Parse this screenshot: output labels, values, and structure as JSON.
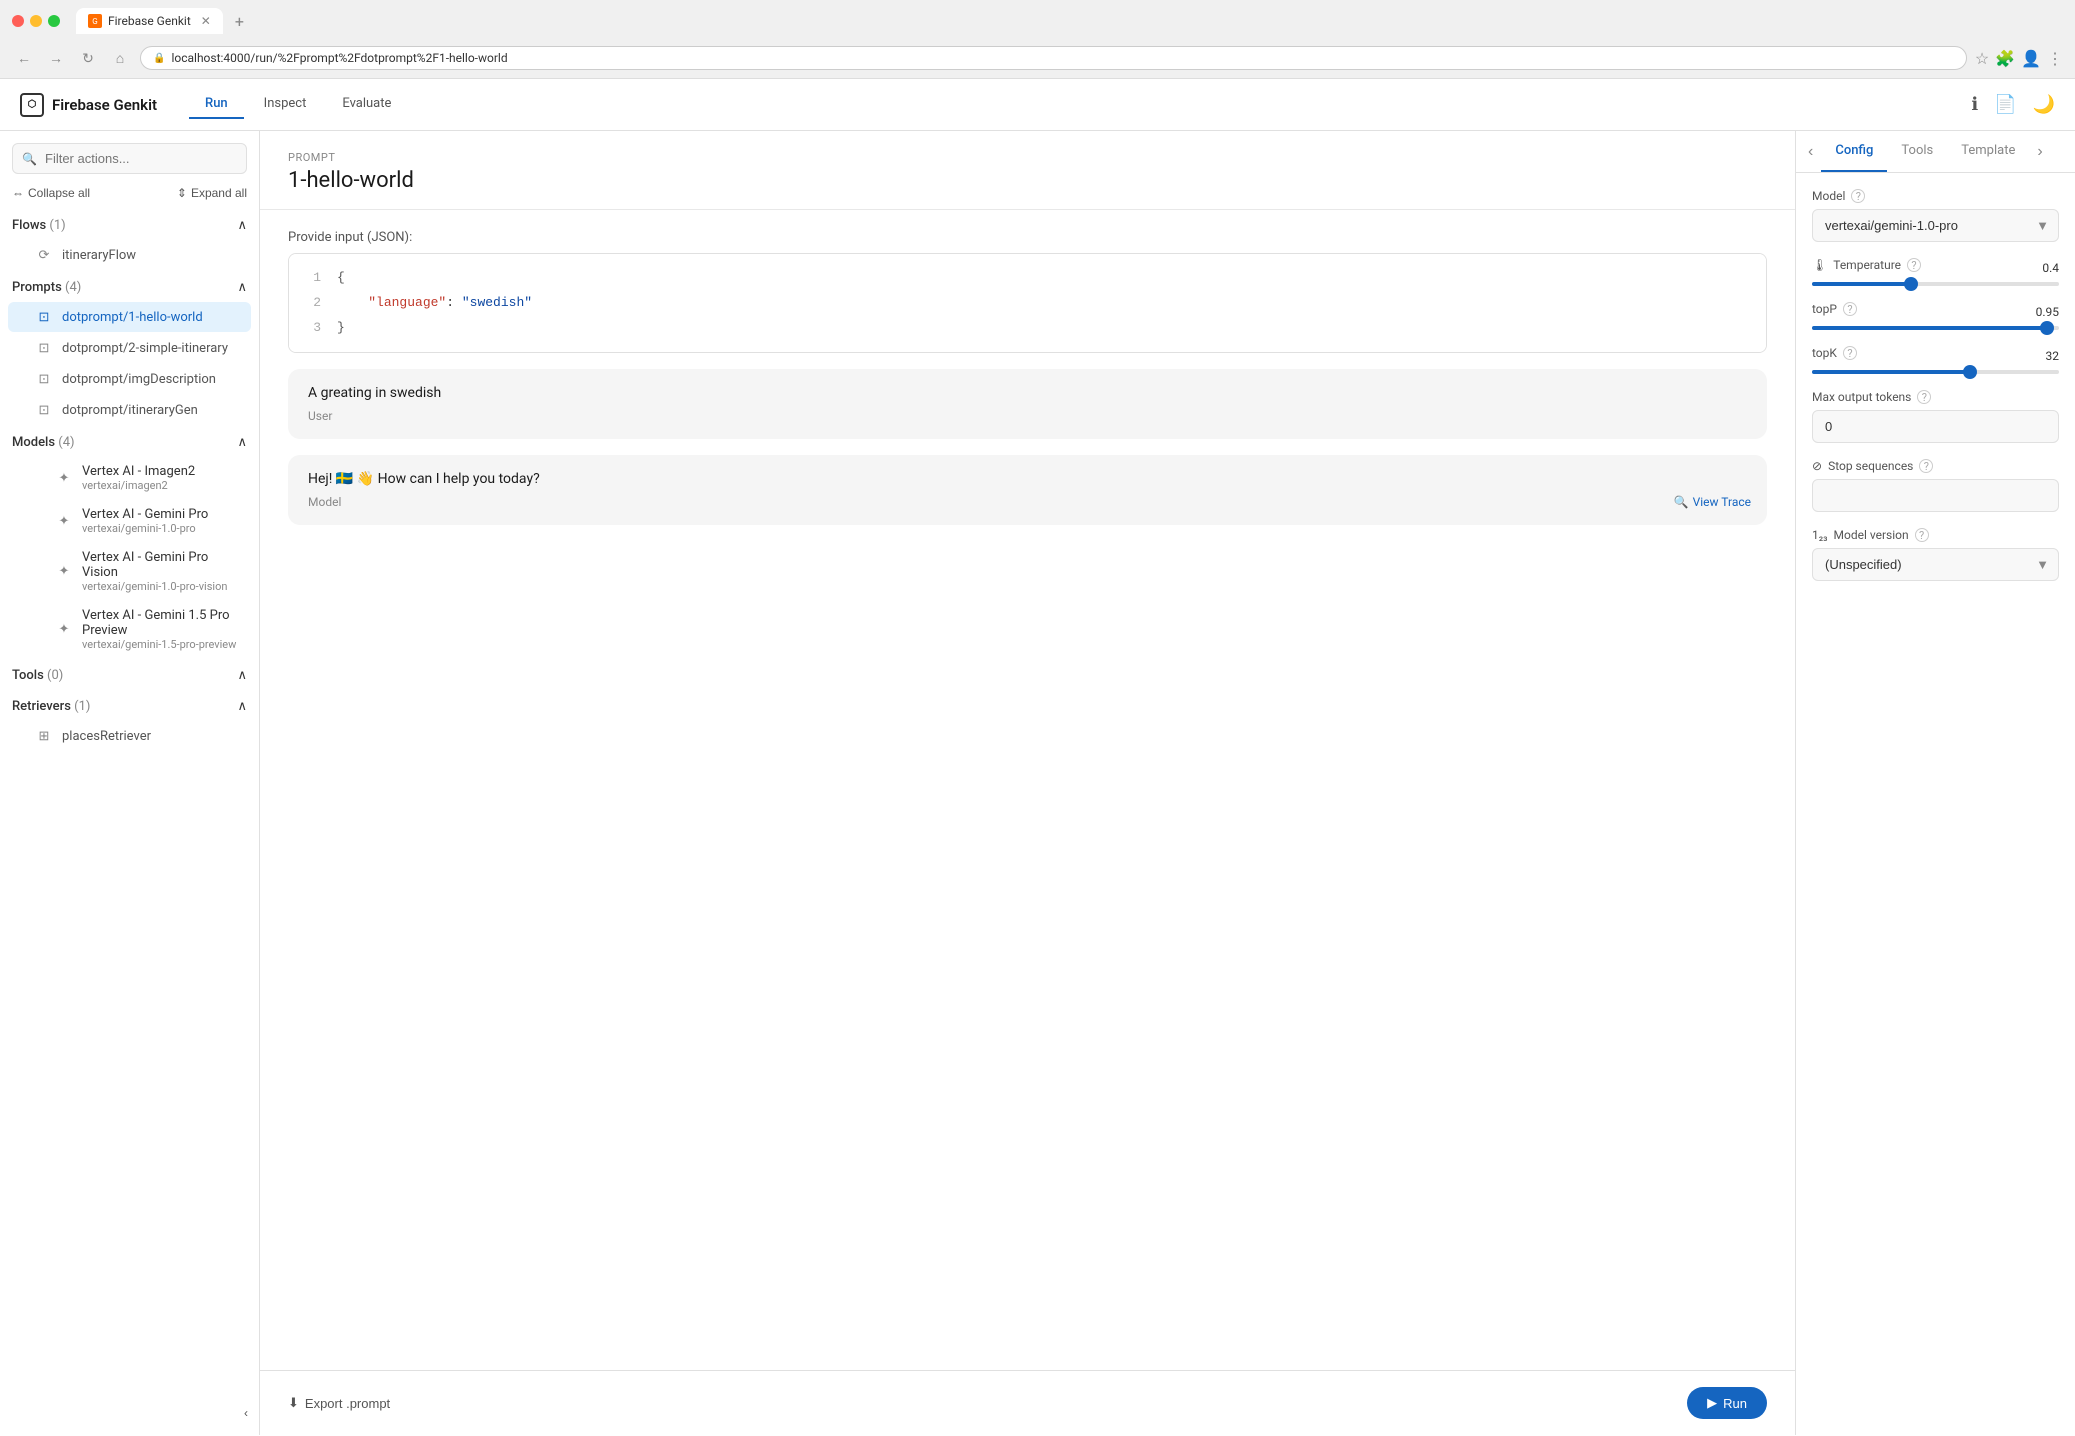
{
  "browser": {
    "url": "localhost:4000/run/%2Fprompt%2Fdotprompt%2F1-hello-world",
    "tab_title": "Firebase Genkit",
    "new_tab_label": "+"
  },
  "app": {
    "logo": "Firebase Genkit",
    "logo_icon": "⬡",
    "nav": {
      "run": "Run",
      "inspect": "Inspect",
      "evaluate": "Evaluate"
    },
    "active_nav": "Run"
  },
  "sidebar": {
    "search_placeholder": "Filter actions...",
    "collapse_all": "Collapse all",
    "expand_all": "Expand all",
    "sections": [
      {
        "title": "Flows",
        "count": "(1)",
        "items": [
          {
            "name": "itineraryFlow",
            "icon": "flow"
          }
        ]
      },
      {
        "title": "Prompts",
        "count": "(4)",
        "items": [
          {
            "name": "dotprompt/1-hello-world",
            "icon": "prompt",
            "active": true
          },
          {
            "name": "dotprompt/2-simple-itinerary",
            "icon": "prompt"
          },
          {
            "name": "dotprompt/imgDescription",
            "icon": "prompt"
          },
          {
            "name": "dotprompt/itineraryGen",
            "icon": "prompt"
          }
        ]
      },
      {
        "title": "Models",
        "count": "(4)",
        "items": [
          {
            "name": "Vertex AI - Imagen2",
            "sub": "vertexai/imagen2",
            "icon": "model"
          },
          {
            "name": "Vertex AI - Gemini Pro",
            "sub": "vertexai/gemini-1.0-pro",
            "icon": "model"
          },
          {
            "name": "Vertex AI - Gemini Pro Vision",
            "sub": "vertexai/gemini-1.0-pro-vision",
            "icon": "model"
          },
          {
            "name": "Vertex AI - Gemini 1.5 Pro Preview",
            "sub": "vertexai/gemini-1.5-pro-preview",
            "icon": "model"
          }
        ]
      },
      {
        "title": "Tools",
        "count": "(0)",
        "items": []
      },
      {
        "title": "Retrievers",
        "count": "(1)",
        "items": [
          {
            "name": "placesRetriever",
            "icon": "retriever"
          }
        ]
      }
    ]
  },
  "prompt": {
    "label": "Prompt",
    "title": "1-hello-world",
    "input_label": "Provide input (JSON):",
    "code_lines": [
      {
        "num": "1",
        "content": "{"
      },
      {
        "num": "2",
        "content": "    \"language\": \"swedish\""
      },
      {
        "num": "3",
        "content": "}"
      }
    ],
    "user_message": "A greating in swedish",
    "user_role": "User",
    "model_message": "Hej! 🇸🇪 👋 How can I help you today?",
    "model_role": "Model",
    "view_trace": "View Trace",
    "export_btn": "Export .prompt",
    "run_btn": "Run"
  },
  "config_panel": {
    "tabs": [
      "Config",
      "Tools",
      "Template"
    ],
    "active_tab": "Config",
    "model_label": "Model",
    "model_value": "vertexai/gemini-1.0-pro",
    "temperature_label": "Temperature",
    "temperature_value": "0.4",
    "temperature_percent": 40,
    "topP_label": "topP",
    "topP_value": "0.95",
    "topP_percent": 95,
    "topK_label": "topK",
    "topK_value": "32",
    "topK_percent": 64,
    "max_tokens_label": "Max output tokens",
    "max_tokens_value": "0",
    "stop_sequences_label": "Stop sequences",
    "stop_sequences_value": "",
    "model_version_label": "Model version",
    "model_version_value": "(Unspecified)"
  }
}
